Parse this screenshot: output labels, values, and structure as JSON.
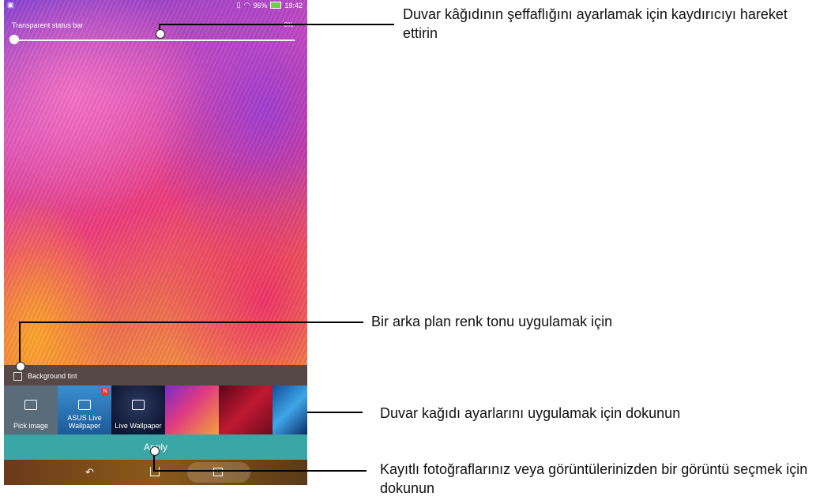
{
  "status_bar": {
    "battery": "96%",
    "time": "19:42"
  },
  "slider": {
    "label": "Transparent status bar",
    "value": "0%",
    "level": 0
  },
  "tint": {
    "label": "Background tint"
  },
  "thumbnails": [
    {
      "label": "Pick image",
      "icon": "image-icon"
    },
    {
      "label": "ASUS Live Wallpaper",
      "icon": "live-wallpaper-icon",
      "badge": "N"
    },
    {
      "label": "Live Wallpaper",
      "icon": "live-wallpaper-icon"
    },
    {
      "label": "",
      "icon": ""
    },
    {
      "label": "",
      "icon": ""
    },
    {
      "label": "",
      "icon": ""
    }
  ],
  "apply_label": "Apply",
  "callouts": {
    "slider": "Duvar kâğıdının şeffaflığını ayarlamak için kaydırıcıyı hareket ettirin",
    "tint": "Bir arka plan renk tonu uygulamak için",
    "apply": "Duvar kağıdı ayarlarını uygulamak için dokunun",
    "pick": "Kayıtlı fotoğraflarınız veya görüntülerinizden bir görüntü seçmek için dokunun"
  },
  "colors": {
    "apply_bar": "#3aa6a6",
    "annotation_text": "#111111"
  }
}
